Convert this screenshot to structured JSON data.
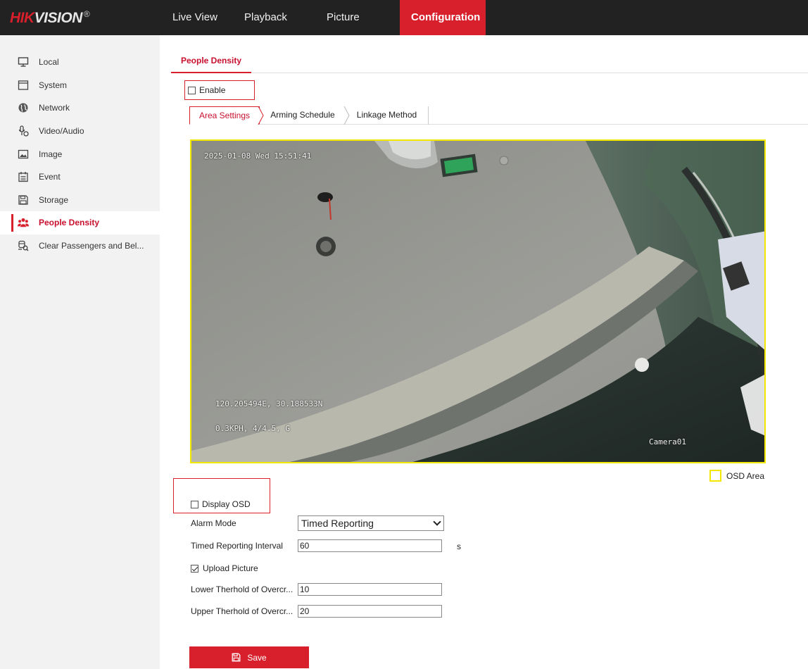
{
  "brand": {
    "logo_red": "HIK",
    "logo_white": "VISION",
    "logo_mark": "®"
  },
  "nav": [
    {
      "label": "Live View",
      "active": false
    },
    {
      "label": "Playback",
      "active": false
    },
    {
      "label": "Picture",
      "active": false
    },
    {
      "label": "Configuration",
      "active": true
    }
  ],
  "sidebar": {
    "items": [
      {
        "label": "Local",
        "icon": "monitor-icon"
      },
      {
        "label": "System",
        "icon": "system-window-icon"
      },
      {
        "label": "Network",
        "icon": "globe-icon"
      },
      {
        "label": "Video/Audio",
        "icon": "microphone-icon"
      },
      {
        "label": "Image",
        "icon": "image-icon"
      },
      {
        "label": "Event",
        "icon": "calendar-icon"
      },
      {
        "label": "Storage",
        "icon": "floppy-disk-icon"
      },
      {
        "label": "People Density",
        "icon": "people-group-icon",
        "active": true
      },
      {
        "label": "Clear Passengers and Bel...",
        "icon": "passenger-search-icon"
      }
    ]
  },
  "page": {
    "tab_title": "People Density",
    "enable_label": "Enable",
    "enable_checked": false,
    "subtabs": [
      "Area Settings",
      "Arming Schedule",
      "Linkage Method"
    ],
    "active_subtab": "Area Settings"
  },
  "video": {
    "osd_datetime": "2025-01-08  Wed 15:51:41",
    "osd_gps": "120.205494E, 30.188533N",
    "osd_speed": "0.3KPH, 4/4.5, G",
    "osd_camera": "Camera01",
    "osd_area_legend": "OSD Area",
    "osd_area_color": "#f3e600"
  },
  "form": {
    "display_osd_label": "Display OSD",
    "display_osd_checked": false,
    "alarm_mode_label": "Alarm Mode",
    "alarm_mode_value": "Timed Reporting",
    "interval_label": "Timed Reporting Interval",
    "interval_value": "60",
    "interval_unit": "s",
    "upload_picture_label": "Upload Picture",
    "upload_picture_checked": true,
    "lower_label": "Lower Therhold of Overcr...",
    "lower_value": "10",
    "upper_label": "Upper Therhold of Overcr...",
    "upper_value": "20"
  },
  "save_label": "Save",
  "colors": {
    "accent": "#d8202c",
    "topbar": "#222222",
    "sidebar": "#f2f2f2"
  }
}
